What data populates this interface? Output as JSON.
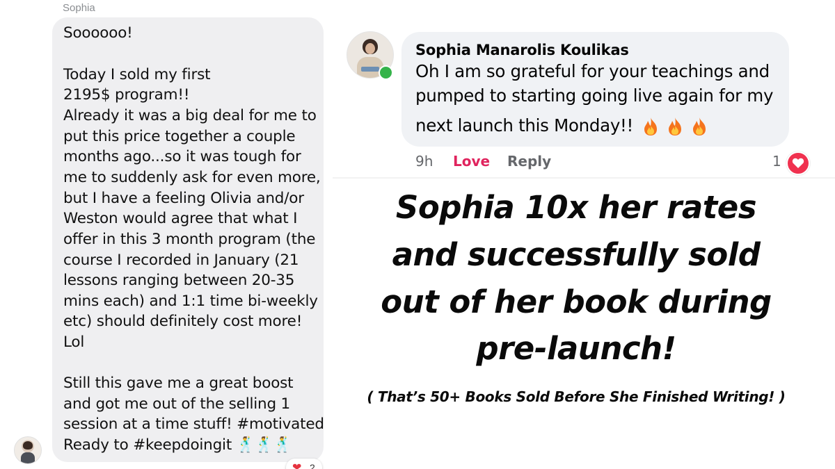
{
  "chat": {
    "sender": "Sophia",
    "lines": [
      "Soooooo!",
      "",
      "Today I sold my first",
      "2195$ program!!",
      "Already it was a big deal for me to",
      "put this price together a couple",
      "months ago...so it was tough for",
      "me to suddenly ask for even more,",
      "but I have a feeling Olivia and/or",
      "Weston would agree that what I",
      "offer in this 3 month program (the",
      "course I recorded in January (21",
      "lessons ranging between 20-35",
      "mins each) and 1:1 time bi-weekly",
      "etc) should definitely cost more!",
      "Lol",
      "",
      "Still this gave me a great boost",
      "and got me out of the selling 1",
      "session at a time stuff! #motivated",
      "Ready to #keepdoingit 🕺🕺🕺"
    ],
    "reaction": {
      "icon": "heart-icon",
      "count": "2"
    }
  },
  "comment": {
    "author": "Sophia Manarolis Koulikas",
    "lines": [
      "Oh I am so grateful for your teachings and",
      "pumped to starting going live again for my",
      "next launch this Monday!!"
    ],
    "emoji_count": 3,
    "time": "9h",
    "love_label": "Love",
    "reply_label": "Reply",
    "reaction_count": "1",
    "colors": {
      "love": "#e0245e",
      "online": "#35b34a",
      "reaction_badge": "#f0314f"
    }
  },
  "headline": {
    "lines": [
      "Sophia 10x her rates",
      "and successfully sold",
      "out of her book during",
      "pre-launch!"
    ],
    "subtitle": "( That’s 50+ Books Sold Before She Finished Writing! )"
  }
}
